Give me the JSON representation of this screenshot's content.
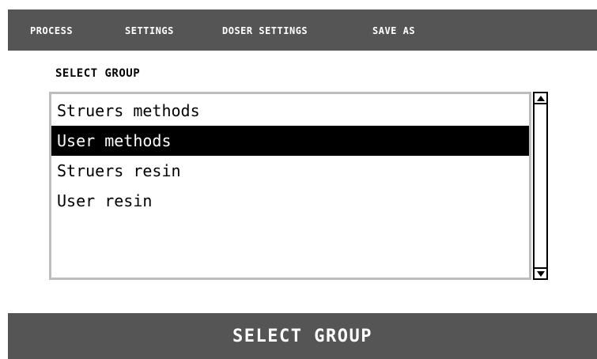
{
  "menu": {
    "items": [
      {
        "label": "PROCESS"
      },
      {
        "label": "SETTINGS"
      },
      {
        "label": "DOSER SETTINGS"
      },
      {
        "label": "SAVE AS"
      }
    ]
  },
  "main": {
    "title": "SELECT GROUP",
    "list": {
      "items": [
        {
          "label": "Struers methods",
          "selected": false
        },
        {
          "label": "User methods",
          "selected": true
        },
        {
          "label": "Struers resin",
          "selected": false
        },
        {
          "label": "User resin",
          "selected": false
        }
      ]
    }
  },
  "scrollbar": {
    "up_icon": "arrow-up-icon",
    "down_icon": "arrow-down-icon"
  },
  "footer": {
    "label": "SELECT GROUP"
  },
  "colors": {
    "bar": "#555555",
    "selection": "#000000",
    "list_border": "#bdbdbd"
  }
}
